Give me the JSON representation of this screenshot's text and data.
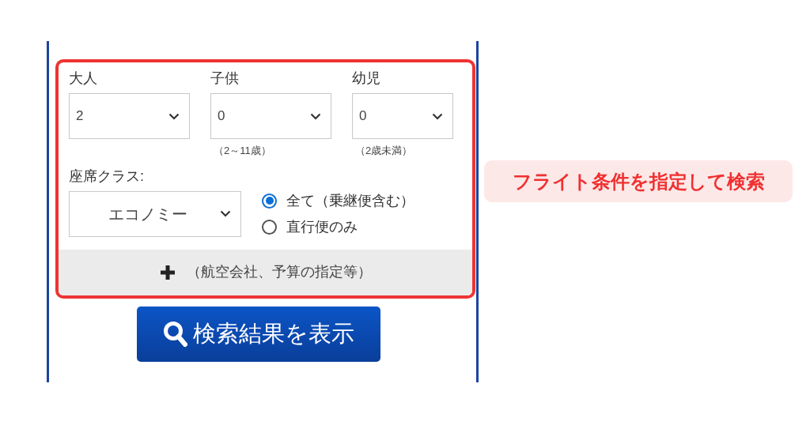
{
  "passengers": [
    {
      "label": "大人",
      "value": "2"
    },
    {
      "label": "子供",
      "value": "0",
      "note": "（2～11歳）"
    },
    {
      "label": "幼児",
      "value": "0",
      "note": "（2歳未満）"
    }
  ],
  "seat_class": {
    "label": "座席クラス:",
    "value": "エコノミー"
  },
  "routes": [
    {
      "label": "全て（乗継便含む）",
      "selected": true
    },
    {
      "label": "直行便のみ",
      "selected": false
    }
  ],
  "more_options": {
    "label": "（航空会社、予算の指定等）"
  },
  "search_button": {
    "label": "検索結果を表示"
  },
  "callout": {
    "text": "フライト条件を指定して検索"
  }
}
